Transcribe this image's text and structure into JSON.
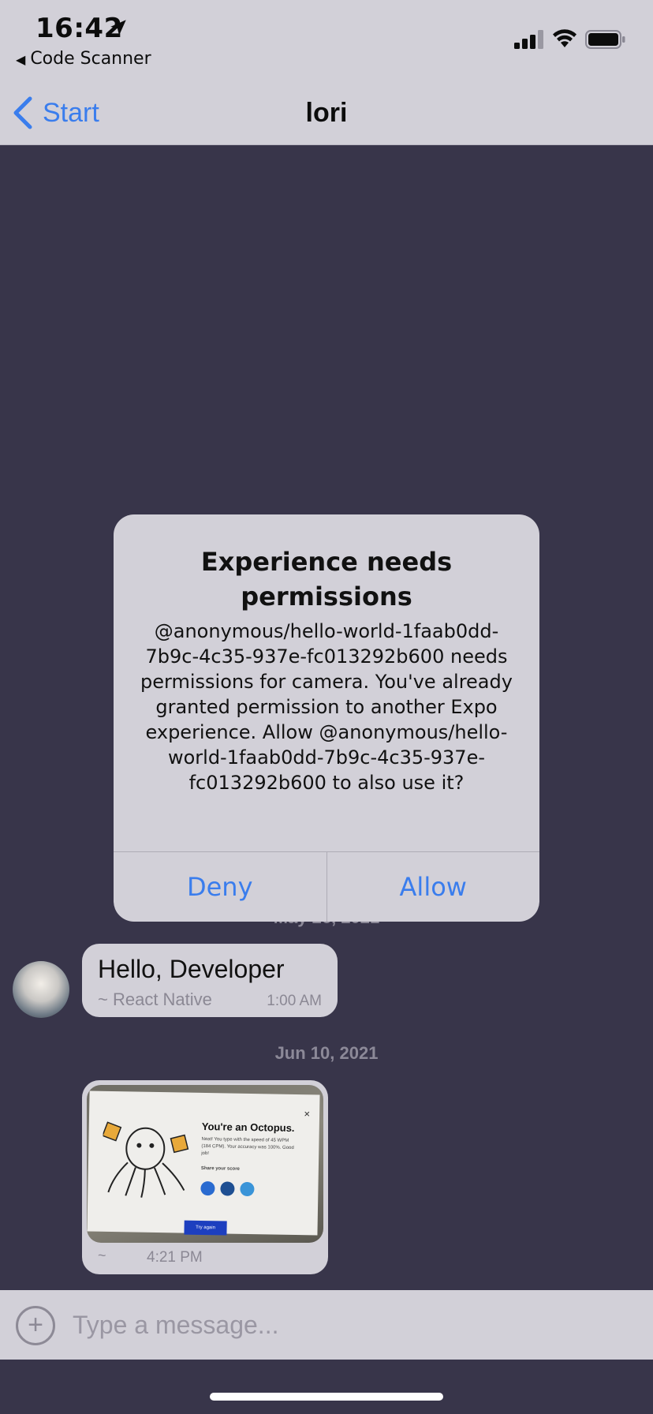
{
  "status_bar": {
    "time": "16:42",
    "back_app": "Code Scanner"
  },
  "nav": {
    "back_label": "Start",
    "title": "lori"
  },
  "alert": {
    "title": "Experience needs permissions",
    "message": "@anonymous/hello-world-1faab0dd-7b9c-4c35-937e-fc013292b600 needs permissions for camera. You've already granted permission to another Expo experience. Allow @anonymous/hello-world-1faab0dd-7b9c-4c35-937e-fc013292b600 to also use it?",
    "deny_label": "Deny",
    "allow_label": "Allow"
  },
  "chat": {
    "date_1": "May 26, 2021",
    "message_1": {
      "text": "Hello, Developer",
      "sender": "~ React Native",
      "time": "1:00 AM"
    },
    "date_2": "Jun 10, 2021",
    "message_2": {
      "sender": "~",
      "time": "4:21 PM",
      "photo": {
        "title": "You're an Octopus.",
        "text": "Neat! You type with the speed of 45 WPM (184 CPM). Your accuracy was 100%. Good job!",
        "share": "Share your score",
        "button": "Try again"
      }
    }
  },
  "composer": {
    "placeholder": "Type a message..."
  },
  "colors": {
    "background": "#38354a",
    "surface": "#d2d0d8",
    "accent": "#3a7ded"
  }
}
